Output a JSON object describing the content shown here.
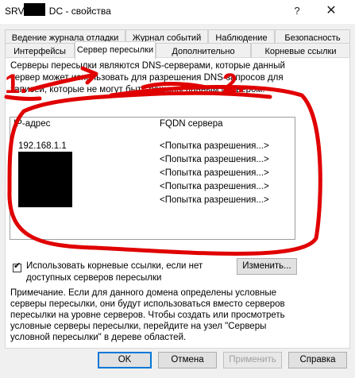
{
  "window": {
    "title_prefix": "SRV-",
    "title_suffix": "DC - свойства",
    "help_glyph": "?",
    "close_glyph": "✕"
  },
  "tabs_row1": [
    "Ведение журнала отладки",
    "Журнал событий",
    "Наблюдение",
    "Безопасность"
  ],
  "tabs_row2": [
    "Интерфейсы",
    "Сервер пересылки",
    "Дополнительно",
    "Корневые ссылки"
  ],
  "active_tab": "Сервер пересылки",
  "description": "Серверы пересылки являются DNS-серверами, которые данный сервер может использовать для разрешения DNS-запросов для записей, которые не могут быть решены данным сервером.",
  "forwarders": {
    "columns": [
      "IP-адрес",
      "FQDN сервера"
    ],
    "rows": [
      {
        "ip": "192.168.1.1",
        "fqdn": "<Попытка разрешения...>"
      },
      {
        "ip": "",
        "fqdn": "<Попытка разрешения...>"
      },
      {
        "ip": "",
        "fqdn": "<Попытка разрешения...>"
      },
      {
        "ip": "",
        "fqdn": "<Попытка разрешения...>"
      },
      {
        "ip": "",
        "fqdn": "<Попытка разрешения...>"
      }
    ]
  },
  "root_hints_checkbox": {
    "checked": true,
    "label": "Использовать корневые ссылки, если нет доступных серверов пересылки"
  },
  "change_button": "Изменить...",
  "note": "Примечание. Если для данного домена определены условные серверы пересылки, они будут использоваться вместо серверов пересылки на уровне серверов.  Чтобы создать или просмотреть условные серверы пересылки, перейдите на узел \"Серверы условной пересылки\" в дереве областей.",
  "buttons": {
    "ok": "OK",
    "cancel": "Отмена",
    "apply": "Применить",
    "help": "Справка"
  },
  "annotations": {
    "label_1": "1.",
    "label_2": "2.",
    "color": "#e00000"
  }
}
